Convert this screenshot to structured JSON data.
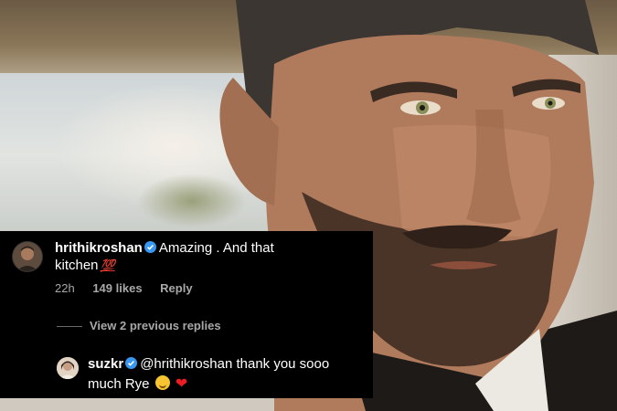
{
  "comment": {
    "username": "hrithikroshan",
    "text_part1": "Amazing . And that",
    "text_part2": "kitchen",
    "emoji": "💯",
    "time": "22h",
    "likes": "149 likes",
    "reply_label": "Reply",
    "verified_icon": "verified-badge-icon",
    "avatar_icon": "user-avatar"
  },
  "view_replies": {
    "label": "View 2 previous replies"
  },
  "reply": {
    "username": "suzkr",
    "mention": "@hrithikroshan",
    "text_part1": "thank you sooo",
    "text_part2": "much Rye",
    "emoji_hug": "hugging-face-emoji",
    "emoji_heart": "❤",
    "verified_icon": "verified-badge-icon",
    "avatar_icon": "user-avatar"
  },
  "colors": {
    "card_background": "#000000",
    "meta_text": "#a8a8a8",
    "verified_blue": "#3897f0",
    "heart_red": "#ec1c24"
  }
}
